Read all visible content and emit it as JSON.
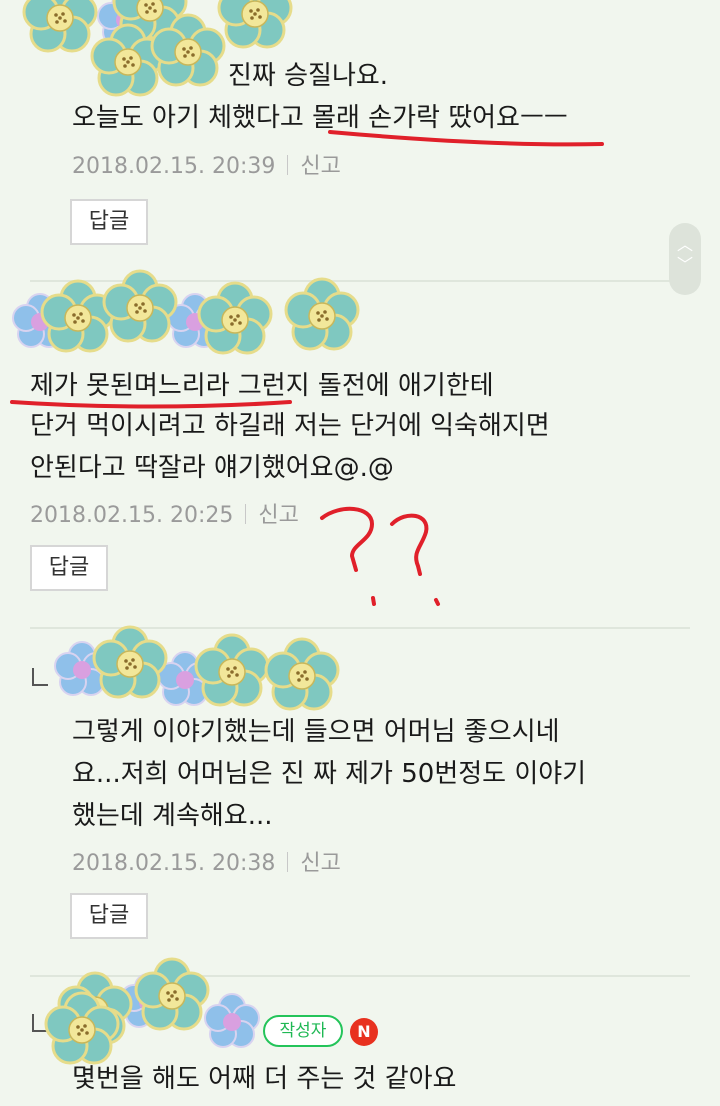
{
  "comments": [
    {
      "line1_visible": "진짜 승질나요.",
      "line2": "오늘도 아기 체했다고 몰래 손가락 땄어요ㅡㅡ",
      "date": "2018.02.15. 20:39",
      "report": "신고",
      "reply": "답글"
    },
    {
      "lines": [
        "제가 못된며느리라 그런지 돌전에 애기한테",
        "단거 먹이시려고 하길래 저는 단거에 익숙해지면",
        "안된다고 딱잘라 얘기했어요@.@"
      ],
      "date": "2018.02.15. 20:25",
      "report": "신고",
      "reply": "답글"
    },
    {
      "lines": [
        "그렇게 이야기했는데 들으면 어머님 좋으시네",
        "요...저희 어머님은 진 짜 제가 50번정도 이야기",
        "했는데 계속해요..."
      ],
      "date": "2018.02.15. 20:38",
      "report": "신고",
      "reply": "답글"
    },
    {
      "author_badge": "작성자",
      "new_badge": "N",
      "line1": "몇번을 해도 어째 더 주는 것 같아요"
    }
  ],
  "scroll_icons": {
    "up": "chevron-up-icon",
    "down": "chevron-down-icon"
  },
  "colors": {
    "background": "#f1f6ee",
    "author_badge": "#1fb854",
    "new_badge": "#e8311f",
    "annotation": "#e0202a"
  }
}
